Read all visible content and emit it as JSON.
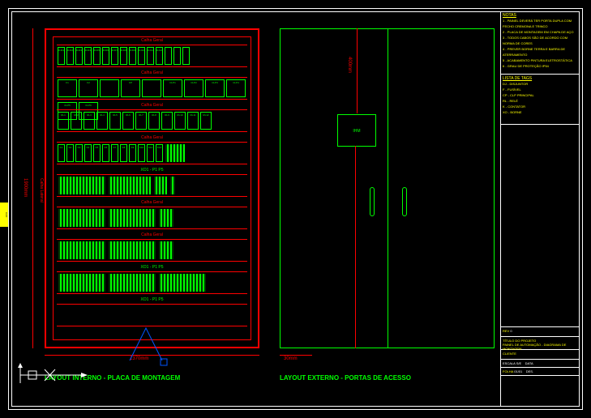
{
  "frame": {
    "border": "double"
  },
  "captions": {
    "left": "LAYOUT INTERNO - PLACA DE MONTAGEM",
    "right": "LAYOUT EXTERNO - PORTAS DE ACESSO"
  },
  "dimensions": {
    "height_mm": "1900mm",
    "width_internal": "1370mm",
    "gap_external": "30mm",
    "ihm_offset": "400mm",
    "side_label": "Calha Lateral"
  },
  "internal_panel": {
    "rows": [
      {
        "label": "Calha Geral",
        "components": [
          "DJ01",
          "DJ02",
          "DJ03",
          "DJ04",
          "DJ05",
          "DJ06",
          "DJ07",
          "DJ08",
          "DJ09",
          "DJ10",
          "DJ11",
          "DJ12",
          "",
          "",
          ""
        ]
      },
      {
        "label": "Calha Geral",
        "components": [
          "F1",
          "F2",
          "",
          "CP",
          "",
          "CLP1",
          "CLP2",
          "CLP3",
          "CLP4",
          "CLP5",
          "CLP6"
        ]
      },
      {
        "label": "Calha Geral",
        "components": [
          "RL1",
          "RL2",
          "RL3",
          "RL4",
          "RL5",
          "RL6",
          "RL7",
          "RL8",
          "RL9",
          "RL10",
          "RL11",
          "RL12"
        ]
      },
      {
        "label": "Calha Geral",
        "components": [
          "K1",
          "K2",
          "K3",
          "K4",
          "K5",
          "K6",
          "K7",
          "K8",
          "K9",
          "K10",
          "K11",
          "K12"
        ],
        "terminal_right": 24
      },
      {
        "label": "XO1 - P1 P5",
        "terminals": [
          58,
          52,
          16,
          6
        ]
      },
      {
        "label": "Calha Geral",
        "terminals": [
          58,
          58,
          18
        ]
      },
      {
        "label": "Calha Geral",
        "terminals": [
          58,
          58,
          18
        ]
      },
      {
        "label": "XO1 - P1 P5",
        "terminals": [
          58,
          58,
          58
        ]
      },
      {
        "label": "XO1 - P1 P5",
        "terminals": []
      }
    ]
  },
  "external_panel": {
    "ihm_label": "IHM",
    "handles": 2
  },
  "titleblock": {
    "notas_header": "NOTAS",
    "notas": [
      "1 - PAINEL DEVERÁ TER PORTA DUPLA COM FECHO CREMONA E TRINCO",
      "2 - PLACA DE MONTAGEM EM CHAPA DE AÇO",
      "3 - TODOS CABOS SÃO DE ACORDO COM NORMA DE CORES",
      "4 - PREVER BORNE TERRA E BARRA DE ATERRAMENTO",
      "5 - ACABAMENTO PINTURA ELETROSTÁTICA",
      "6 - GRAU DE PROTEÇÃO IP54"
    ],
    "legenda_header": "LISTA DE TAGS",
    "legenda": [
      "DJ - DISJUNTOR",
      "F - FUSÍVEL",
      "CP - CLP PRINCIPAL",
      "RL - RELÉ",
      "K - CONTATOR",
      "XO - BORNE"
    ],
    "project": {
      "title_label": "TÍTULO DO PROJETO",
      "title": "PAINEL DE AUTOMAÇÃO - DIAGRAMA DE MONTAGEM",
      "client_label": "CLIENTE",
      "rev_label": "REV",
      "rev": "0",
      "sheet_label": "FOLHA",
      "sheet": "01/01",
      "scale_label": "ESCALA",
      "scale": "S/E",
      "drawn_label": "DES.",
      "date_label": "DATA"
    }
  },
  "cad_watermark": "CAD"
}
